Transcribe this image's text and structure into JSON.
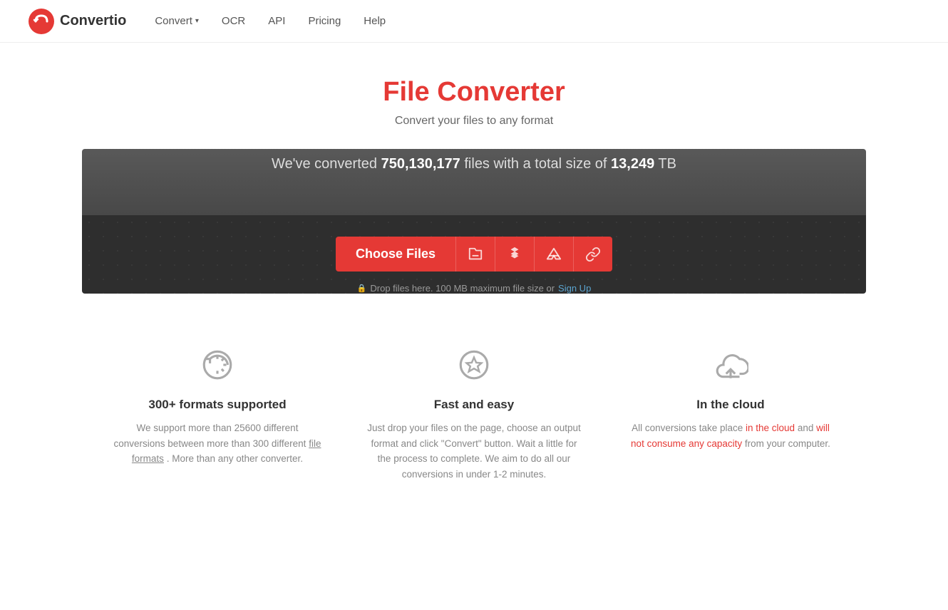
{
  "nav": {
    "logo_text": "Convertio",
    "links": [
      {
        "id": "convert",
        "label": "Convert",
        "has_dropdown": true
      },
      {
        "id": "ocr",
        "label": "OCR",
        "has_dropdown": false
      },
      {
        "id": "api",
        "label": "API",
        "has_dropdown": false
      },
      {
        "id": "pricing",
        "label": "Pricing",
        "has_dropdown": false
      },
      {
        "id": "help",
        "label": "Help",
        "has_dropdown": false
      }
    ]
  },
  "hero": {
    "title": "File Converter",
    "subtitle": "Convert your files to any format"
  },
  "converter": {
    "stats_prefix": "We've converted ",
    "stats_number": "750,130,177",
    "stats_middle": " files with a total size of ",
    "stats_size": "13,249",
    "stats_suffix": " TB",
    "choose_files_label": "Choose Files",
    "drop_info": "Drop files here. 100 MB maximum file size or",
    "signup_link": "Sign Up"
  },
  "features": [
    {
      "id": "formats",
      "icon": "refresh-icon",
      "title": "300+ formats supported",
      "description": "We support more than 25600 different conversions between more than 300 different",
      "link_text": "file formats",
      "description_after": ". More than any other converter."
    },
    {
      "id": "fast",
      "icon": "star-icon",
      "title": "Fast and easy",
      "description": "Just drop your files on the page, choose an output format and click \"Convert\" button. Wait a little for the process to complete. We aim to do all our conversions in under 1-2 minutes."
    },
    {
      "id": "cloud",
      "icon": "cloud-icon",
      "title": "In the cloud",
      "description_before": "All conversions take place ",
      "highlight1": "in the cloud",
      "description_middle": " and ",
      "highlight2": "will not consume any capacity",
      "description_after": " from your computer."
    }
  ]
}
